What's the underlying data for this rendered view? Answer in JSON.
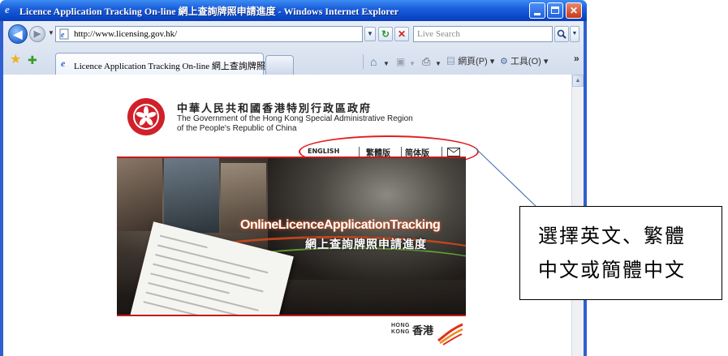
{
  "window": {
    "title": "Licence Application Tracking On-line 網上查詢牌照申請進度 - Windows Internet Explorer"
  },
  "address_bar": {
    "url": "http://www.licensing.gov.hk/"
  },
  "search": {
    "placeholder": "Live Search"
  },
  "tabs": [
    {
      "label": "Licence Application Tracking On-line 網上查詢牌照..."
    }
  ],
  "command_bar": {
    "page_label": "網頁(P)",
    "tools_label": "工具(O)"
  },
  "page": {
    "gov_name_zh": "中華人民共和國香港特別行政區政府",
    "gov_name_en_line1": "The Government of the Hong Kong Special Administrative Region",
    "gov_name_en_line2": "of the People's Republic of China",
    "languages": {
      "english": "ENGLISH",
      "traditional": "繁體版",
      "simplified": "简体版"
    },
    "banner": {
      "title_en": "OnlineLicenceApplicationTracking",
      "title_zh": "網上查詢牌照申請進度"
    },
    "brand": {
      "text_en_line1": "HONG",
      "text_en_line2": "KONG",
      "text_zh": "香港"
    }
  },
  "callout": {
    "line1": "選擇英文、繁體",
    "line2": "中文或簡體中文"
  },
  "colors": {
    "titlebar": "#0a48c8",
    "highlight": "#e21e1e",
    "accent_red": "#c21a1a"
  }
}
